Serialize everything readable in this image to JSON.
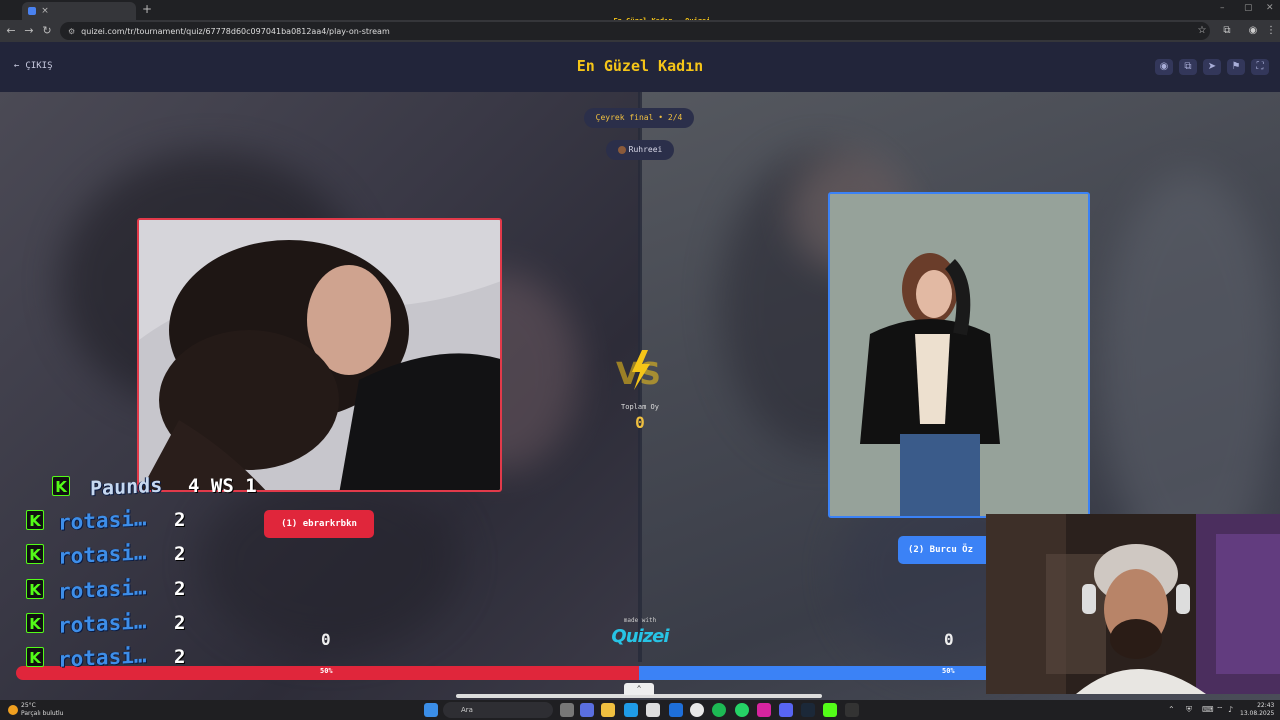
{
  "browser": {
    "tab_title": "En Güzel Kadın - Quizei",
    "tab_close": "×",
    "new_tab": "+",
    "url": "quizei.com/tr/tournament/quiz/67778d60c097041ba0812aa4/play-on-stream",
    "window_controls": [
      "–",
      "▢",
      "✕"
    ]
  },
  "header": {
    "back_label": "ÇIKIŞ",
    "title": "En Güzel Kadın",
    "icons": [
      "eye-icon",
      "link-icon",
      "send-icon",
      "flag-icon",
      "fullscreen-icon"
    ]
  },
  "round": {
    "stage": "Çeyrek final • 2/4",
    "author": "Ruhreei"
  },
  "contest": {
    "left_name": "(1) ebrarkrbkn",
    "right_name": "(2) Burcu Öz",
    "total_label": "Toplam Oy",
    "total_value": "0",
    "left_score": "0",
    "right_score": "0",
    "left_percent": "50%",
    "right_percent": "50%",
    "made_with": "made with",
    "brand": "Quizei",
    "colors": {
      "left": "#e0263b",
      "right": "#3b82f6",
      "accent": "#f5c518"
    }
  },
  "overlay": {
    "top_name": "Paunds",
    "top_stat": "4 WS 1",
    "rows": [
      {
        "name": "rotasi…",
        "value": "2"
      },
      {
        "name": "rotasi…",
        "value": "2"
      },
      {
        "name": "rotasi…",
        "value": "2"
      },
      {
        "name": "rotasi…",
        "value": "2"
      },
      {
        "name": "rotasi…",
        "value": "2"
      }
    ]
  },
  "taskbar": {
    "temp": "25°C",
    "weather": "Parçalı bulutlu",
    "search": "Ara",
    "time": "22:43",
    "date": "13.08.2025"
  }
}
